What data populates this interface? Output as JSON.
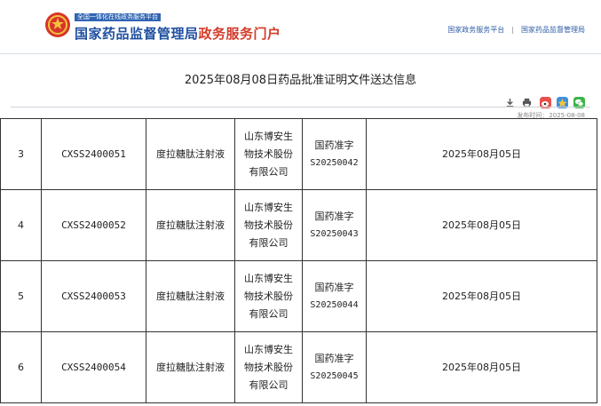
{
  "header": {
    "small_label": "全国一体化在线政务服务平台",
    "title_main": "国家药品监督管理局",
    "title_accent": "政务服务门户",
    "links": [
      "国家政务服务平台",
      "国家药品监督管理局"
    ],
    "separator": "|"
  },
  "article": {
    "title": "2025年08月08日药品批准证明文件送达信息",
    "publish_label": "发布时间：",
    "publish_date": "2025-08-08"
  },
  "colors": {
    "brand_blue": "#1f4fa0",
    "accent_red": "#d33b2a"
  },
  "icons": [
    "download-icon",
    "print-icon",
    "weibo-icon",
    "qzone-icon",
    "wechat-icon"
  ],
  "table": {
    "rows": [
      {
        "no": "3",
        "code": "CXSS2400051",
        "name": "度拉糖肽注射液",
        "company": [
          "山东博安生",
          "物技术股份",
          "有限公司"
        ],
        "approval": [
          "国药准字",
          "S20250042"
        ],
        "date": "2025年08月05日"
      },
      {
        "no": "4",
        "code": "CXSS2400052",
        "name": "度拉糖肽注射液",
        "company": [
          "山东博安生",
          "物技术股份",
          "有限公司"
        ],
        "approval": [
          "国药准字",
          "S20250043"
        ],
        "date": "2025年08月05日"
      },
      {
        "no": "5",
        "code": "CXSS2400053",
        "name": "度拉糖肽注射液",
        "company": [
          "山东博安生",
          "物技术股份",
          "有限公司"
        ],
        "approval": [
          "国药准字",
          "S20250044"
        ],
        "date": "2025年08月05日"
      },
      {
        "no": "6",
        "code": "CXSS2400054",
        "name": "度拉糖肽注射液",
        "company": [
          "山东博安生",
          "物技术股份",
          "有限公司"
        ],
        "approval": [
          "国药准字",
          "S20250045"
        ],
        "date": "2025年08月05日"
      }
    ]
  }
}
